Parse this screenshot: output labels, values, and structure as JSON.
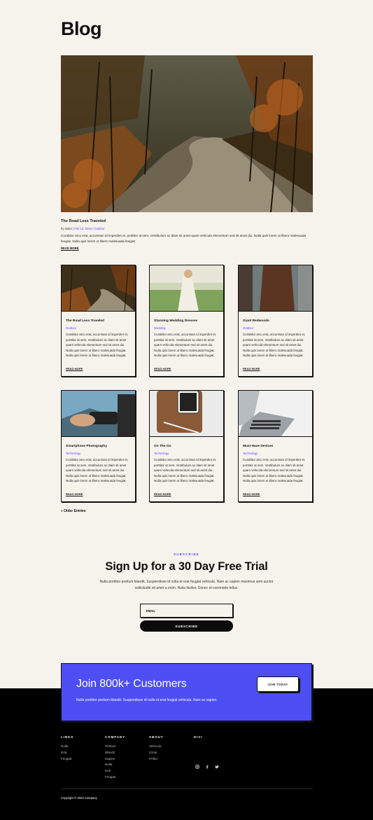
{
  "page": {
    "title": "Blog"
  },
  "hero": {
    "title": "The Road Less Traveled",
    "meta_by": "by etdev",
    "meta_date": "Feb 12, 2018",
    "meta_cat": "Outdoor",
    "excerpt": "Curabitur arcu erat, accumsan id imperdiet et, porttitor at sem. Vestibulum ac diam sit amet quam vehicula elementum sed sit amet dui. Nulla quis lorem ut libero malesuada feugiat. Nulla quis lorem ut libero malesuada feugiat.",
    "read_more": "READ MORE"
  },
  "cards": [
    {
      "title": "The Road Less Traveled",
      "category": "Outdoor",
      "excerpt": "Curabitur arcu erat, accumsan id imperdiet et, porttitor at sem. Vestibulum ac diam sit amet quam vehicula elementum sed sit amet dui. Nulla quis lorem ut libero malesuada feugiat. Nulla quis lorem ut libero malesuada feugiat.",
      "read_more": "READ MORE"
    },
    {
      "title": "Stunning Wedding Dresses",
      "category": "Wedding",
      "excerpt": "Curabitur arcu erat, accumsan id imperdiet et, porttitor at sem. Vestibulum ac diam sit amet quam vehicula elementum sed sit amet dui. Nulla quis lorem ut libero malesuada feugiat. Nulla quis lorem ut libero malesuada feugiat.",
      "read_more": "READ MORE"
    },
    {
      "title": "Giant Redwoods",
      "category": "Outdoor",
      "excerpt": "Curabitur arcu erat, accumsan id imperdiet et, porttitor at sem. Vestibulum ac diam sit amet quam vehicula elementum sed sit amet dui. Nulla quis lorem ut libero malesuada feugiat. Nulla quis lorem ut libero malesuada feugiat.",
      "read_more": "READ MORE"
    },
    {
      "title": "Smartphone Photography",
      "category": "Technology",
      "excerpt": "Curabitur arcu erat, accumsan id imperdiet et, porttitor at sem. Vestibulum ac diam sit amet quam vehicula elementum sed sit amet dui. Nulla quis lorem ut libero malesuada feugiat. Nulla quis lorem ut libero malesuada feugiat.",
      "read_more": "READ MORE"
    },
    {
      "title": "On The Go",
      "category": "Technology",
      "excerpt": "Curabitur arcu erat, accumsan id imperdiet et, porttitor at sem. Vestibulum ac diam sit amet quam vehicula elementum sed sit amet dui. Nulla quis lorem ut libero malesuada feugiat. Nulla quis lorem ut libero malesuada feugiat.",
      "read_more": "READ MORE"
    },
    {
      "title": "Must Have Devices",
      "category": "Technology",
      "excerpt": "Curabitur arcu erat, accumsan id imperdiet et, porttitor at sem. Vestibulum ac diam sit amet quam vehicula elementum sed sit amet dui. Nulla quis lorem ut libero malesuada feugiat. Nulla quis lorem ut libero malesuada feugiat.",
      "read_more": "READ MORE"
    }
  ],
  "pagination": {
    "older": "« Older Entries"
  },
  "subscribe": {
    "eyebrow": "SUBSCRIBE",
    "title": "Sign Up for a 30 Day Free Trial",
    "text": "Nulla porttitor pretium blandit. Suspendisse id nulla et erat feugiat vehicula. Nam ac sapien maximus sem auctor sollicitudin sit amet a enim. Nulla facilisi. Donec et commodo tellus.",
    "email_placeholder": "EMAIL",
    "button": "SUBSCRIBE"
  },
  "cta": {
    "title": "Join 800k+ Customers",
    "text": "Nulla porttitor pretium blandit. Suspendisse id nulla et erat feugiat vehicula. Nam ac sapien.",
    "button": "JOIN TODAY"
  },
  "footer": {
    "columns": [
      {
        "heading": "LINKS",
        "links": [
          "Nulla",
          "Erat",
          "Feugiat"
        ]
      },
      {
        "heading": "COMPANY",
        "links": [
          "Pretium",
          "Blandit",
          "Sapien",
          "Nulla",
          "Erat",
          "Feugiat"
        ]
      },
      {
        "heading": "ABOUT",
        "links": [
          "Vehicula",
          "Ornai",
          "Prittor"
        ]
      },
      {
        "heading": "DIVI",
        "links": []
      }
    ],
    "social": [
      "instagram-icon",
      "facebook-icon",
      "twitter-icon"
    ],
    "copyright": "Copyright © 2022 Company"
  },
  "colors": {
    "background": "#f6f2ec",
    "accent": "#5a4bff",
    "cta": "#4d4ef4",
    "footer": "#000000"
  }
}
